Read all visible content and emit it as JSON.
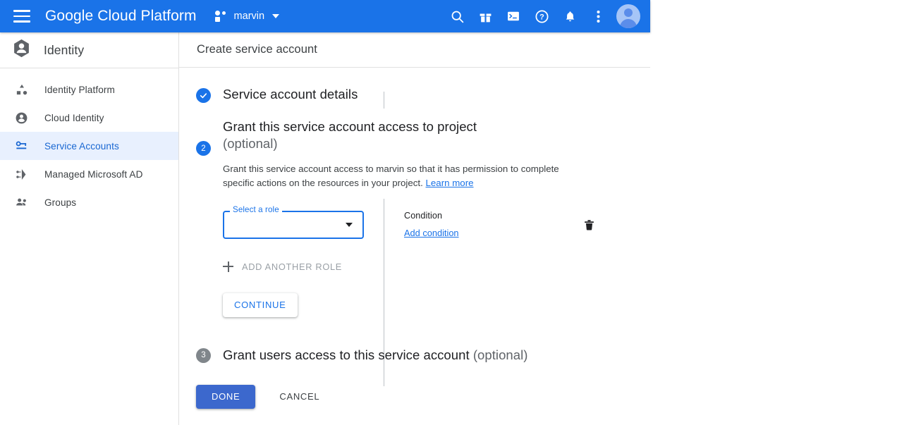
{
  "header": {
    "menu_icon": "hamburger-menu-icon",
    "brand": "Google Cloud Platform",
    "project_name": "marvin",
    "project_caret": "chevron-down-icon",
    "actions": [
      {
        "name": "search-icon",
        "label": "Search"
      },
      {
        "name": "gift-icon",
        "label": "Products and offers"
      },
      {
        "name": "cloud-shell-icon",
        "label": "Activate Cloud Shell"
      },
      {
        "name": "help-icon",
        "label": "Help"
      },
      {
        "name": "notifications-icon",
        "label": "Notifications"
      },
      {
        "name": "more-options-icon",
        "label": "More options"
      }
    ],
    "avatar_label": "Account"
  },
  "sidebar": {
    "title": "Identity",
    "title_icon": "identity-hexagon-icon",
    "items": [
      {
        "label": "Identity Platform",
        "icon": "identity-platform-icon",
        "active": false
      },
      {
        "label": "Cloud Identity",
        "icon": "cloud-identity-icon",
        "active": false
      },
      {
        "label": "Service Accounts",
        "icon": "service-accounts-icon",
        "active": true
      },
      {
        "label": "Managed Microsoft AD",
        "icon": "managed-microsoft-ad-icon",
        "active": false
      },
      {
        "label": "Groups",
        "icon": "groups-icon",
        "active": false
      }
    ]
  },
  "page": {
    "title": "Create service account"
  },
  "wizard": {
    "step1": {
      "number": "1",
      "title": "Service account details",
      "state": "completed"
    },
    "step2": {
      "number": "2",
      "title": "Grant this service account access to project",
      "optional": "(optional)",
      "description_part1": "Grant this service account access to marvin so that it has permission to complete specific actions on the resources in your project.",
      "learn_more": "Learn more",
      "role_select": {
        "label": "Select a role",
        "value": "",
        "arrow_icon": "chevron-down-icon"
      },
      "condition": {
        "label": "Condition",
        "add_link": "Add condition",
        "delete_icon": "trash-icon"
      },
      "add_another_role": "ADD ANOTHER ROLE",
      "continue": "CONTINUE"
    },
    "step3": {
      "number": "3",
      "title": "Grant users access to this service account",
      "optional": "(optional)",
      "state": "inactive"
    }
  },
  "footer": {
    "done": "DONE",
    "cancel": "CANCEL"
  },
  "colors": {
    "brand_blue": "#1a73e8",
    "header_blue": "#1a73e8",
    "active_nav_bg": "#e8f0fe",
    "active_nav_fg": "#1967d2",
    "done_button": "#3c68cd",
    "idle_badge": "#80868b",
    "muted_text": "#5f6368",
    "disabled_text": "#9aa0a6"
  }
}
